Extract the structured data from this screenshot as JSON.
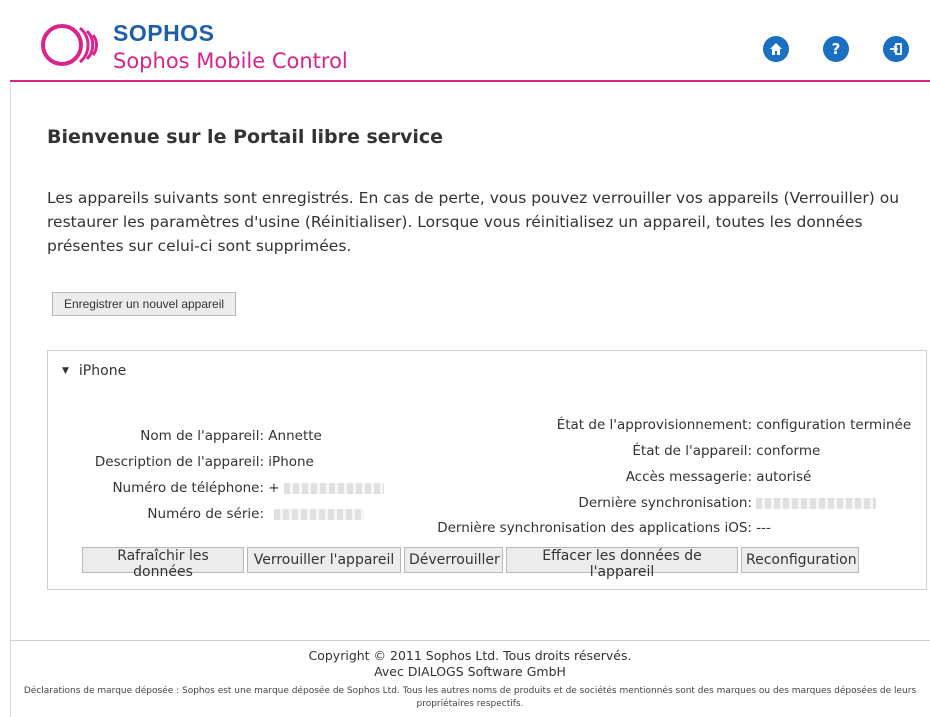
{
  "header": {
    "brand_name": "SOPHOS",
    "product_name": "Sophos Mobile Control",
    "accent_color": "#d9248b",
    "brand_color": "#1f5fa8",
    "icons": [
      "home-icon",
      "help-icon",
      "logout-icon"
    ]
  },
  "main": {
    "title": "Bienvenue sur le Portail libre service",
    "intro": "Les appareils suivants sont enregistrés. En cas de perte, vous pouvez verrouiller vos appareils (Verrouiller) ou restaurer les paramètres d'usine (Réinitialiser). Lorsque vous réinitialisez un appareil, toutes les données présentes sur celui-ci sont supprimées.",
    "register_button": "Enregistrer un nouvel appareil"
  },
  "device": {
    "name": "iPhone",
    "left_fields": [
      {
        "label": "Nom de l'appareil:",
        "value": "Annette"
      },
      {
        "label": "Description de l'appareil:",
        "value": "iPhone"
      },
      {
        "label": "Numéro de téléphone:",
        "value": "+"
      },
      {
        "label": "Numéro de série:",
        "value": ""
      }
    ],
    "right_fields": [
      {
        "label": "État de l'approvisionnement:",
        "value": "configuration terminée"
      },
      {
        "label": "État de l'appareil:",
        "value": "conforme"
      },
      {
        "label": "Accès messagerie:",
        "value": "autorisé"
      },
      {
        "label": "Dernière synchronisation:",
        "value": ""
      },
      {
        "label": "Dernière synchronisation des applications iOS:",
        "value": "---"
      }
    ],
    "actions": [
      "Rafraîchir les données",
      "Verrouiller l'appareil",
      "Déverrouiller",
      "Effacer les données de l'appareil",
      "Reconfiguration"
    ]
  },
  "footer": {
    "copyright": "Copyright © 2011 Sophos Ltd. Tous droits réservés.",
    "partner": "Avec DIALOGS Software GmbH",
    "trademark": "Déclarations de marque déposée : Sophos est une marque déposée de Sophos Ltd. Tous les autres noms de produits et de sociétés mentionnés sont des marques ou des marques déposées de leurs propriétaires respectifs."
  }
}
